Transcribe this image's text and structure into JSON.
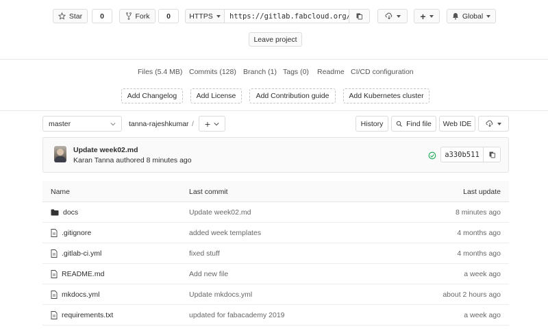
{
  "toolbar": {
    "star_label": "Star",
    "star_count": "0",
    "fork_label": "Fork",
    "fork_count": "0",
    "protocol": "HTTPS",
    "clone_url": "https://gitlab.fabcloud.org/",
    "notification_label": "Global",
    "leave_label": "Leave project"
  },
  "stats": {
    "files": "Files (5.4 MB)",
    "commits": "Commits (128)",
    "branch": "Branch (1)",
    "tags": "Tags (0)",
    "readme": "Readme",
    "cicd": "CI/CD configuration"
  },
  "actions": {
    "changelog": "Add Changelog",
    "license": "Add License",
    "contribution": "Add Contribution guide",
    "kubernetes": "Add Kubernetes cluster"
  },
  "nav": {
    "branch": "master",
    "path": "tanna-rajeshkumar",
    "separator": "/",
    "history": "History",
    "find_file": "Find file",
    "web_ide": "Web IDE"
  },
  "commit": {
    "title": "Update week02.md",
    "author": "Karan Tanna",
    "meta": "authored 8 minutes ago",
    "sha": "a330b511"
  },
  "table": {
    "headers": {
      "name": "Name",
      "last_commit": "Last commit",
      "last_update": "Last update"
    },
    "rows": [
      {
        "name": "docs",
        "commit": "Update week02.md",
        "update": "8 minutes ago",
        "icon": "folder-icon"
      },
      {
        "name": ".gitignore",
        "commit": "added week templates",
        "update": "4 months ago",
        "icon": "file-icon"
      },
      {
        "name": ".gitlab-ci.yml",
        "commit": "fixed stuff",
        "update": "4 months ago",
        "icon": "file-icon"
      },
      {
        "name": "README.md",
        "commit": "Add new file",
        "update": "a week ago",
        "icon": "file-icon"
      },
      {
        "name": "mkdocs.yml",
        "commit": "Update mkdocs.yml",
        "update": "about 2 hours ago",
        "icon": "file-icon"
      },
      {
        "name": "requirements.txt",
        "commit": "updated for fabacademy 2019",
        "update": "a week ago",
        "icon": "file-icon"
      }
    ]
  }
}
